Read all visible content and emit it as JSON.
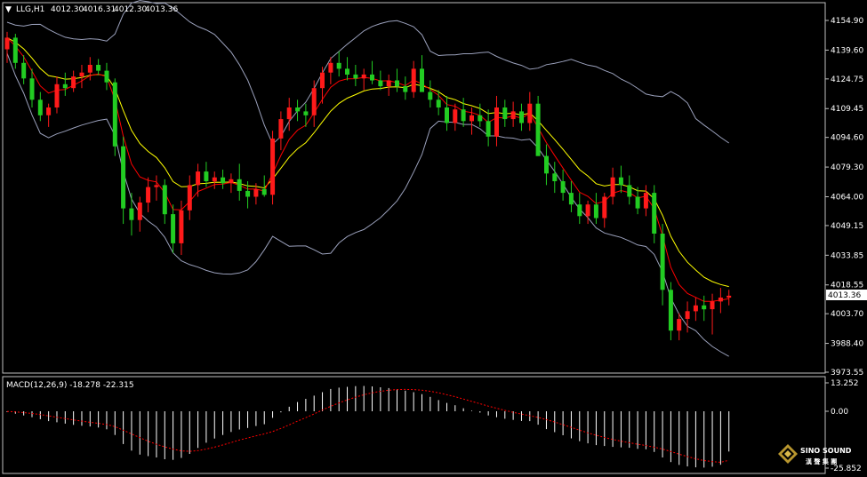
{
  "header": {
    "arrow": "▼",
    "symbol": "LLG,H1",
    "open": "4012.30",
    "high": "4016.31",
    "low": "4012.30",
    "close": "4013.36"
  },
  "current_price_label": "4013.36",
  "macd_label": "MACD(12,26,9) -18.278 -22.315",
  "brand": {
    "name": "SINO SOUND",
    "chinese": "漢 聲 集 團"
  },
  "colors": {
    "background": "#000000",
    "up_candle": "#ff1a1a",
    "down_candle": "#22cc22",
    "fast_ma": "#ff0000",
    "slow_ma": "#ffff00",
    "bollinger": "#9aa0bb",
    "macd_histogram": "#ffffff",
    "macd_signal": "#ff0000",
    "frame": "#c0c0c0"
  },
  "chart_data": [
    {
      "type": "candlestick",
      "timeframe": "H1",
      "y_ticks": [
        "4154.90",
        "4139.60",
        "4124.75",
        "4109.45",
        "4094.60",
        "4079.30",
        "4064.00",
        "4049.15",
        "4033.85",
        "4018.55",
        "4003.70",
        "3988.40",
        "3973.55"
      ],
      "ylim": [
        3970,
        4165
      ],
      "ohlc": [
        [
          4140,
          4149,
          4133,
          4146
        ],
        [
          4146,
          4148,
          4130,
          4133
        ],
        [
          4133,
          4137,
          4122,
          4125
        ],
        [
          4125,
          4130,
          4110,
          4114
        ],
        [
          4114,
          4118,
          4103,
          4106
        ],
        [
          4106,
          4112,
          4100,
          4110
        ],
        [
          4110,
          4126,
          4107,
          4122
        ],
        [
          4122,
          4128,
          4116,
          4120
        ],
        [
          4120,
          4129,
          4118,
          4126
        ],
        [
          4126,
          4132,
          4120,
          4128
        ],
        [
          4128,
          4136,
          4124,
          4132
        ],
        [
          4132,
          4135,
          4127,
          4129
        ],
        [
          4129,
          4133,
          4119,
          4123
        ],
        [
          4123,
          4125,
          4085,
          4090
        ],
        [
          4090,
          4095,
          4050,
          4058
        ],
        [
          4058,
          4066,
          4044,
          4052
        ],
        [
          4052,
          4064,
          4046,
          4061
        ],
        [
          4061,
          4074,
          4056,
          4069
        ],
        [
          4069,
          4075,
          4062,
          4070
        ],
        [
          4070,
          4073,
          4050,
          4055
        ],
        [
          4055,
          4060,
          4035,
          4040
        ],
        [
          4040,
          4062,
          4034,
          4057
        ],
        [
          4057,
          4075,
          4052,
          4070
        ],
        [
          4070,
          4081,
          4064,
          4077
        ],
        [
          4077,
          4082,
          4069,
          4072
        ],
        [
          4072,
          4077,
          4068,
          4074
        ],
        [
          4074,
          4078,
          4068,
          4071
        ],
        [
          4071,
          4076,
          4066,
          4073
        ],
        [
          4073,
          4081,
          4062,
          4067
        ],
        [
          4067,
          4072,
          4058,
          4064
        ],
        [
          4064,
          4071,
          4060,
          4068
        ],
        [
          4068,
          4075,
          4064,
          4065
        ],
        [
          4065,
          4098,
          4060,
          4094
        ],
        [
          4094,
          4108,
          4088,
          4104
        ],
        [
          4104,
          4115,
          4098,
          4110
        ],
        [
          4110,
          4114,
          4103,
          4108
        ],
        [
          4108,
          4112,
          4100,
          4106
        ],
        [
          4106,
          4124,
          4100,
          4120
        ],
        [
          4120,
          4131,
          4112,
          4128
        ],
        [
          4128,
          4136,
          4122,
          4133
        ],
        [
          4133,
          4139,
          4126,
          4130
        ],
        [
          4130,
          4136,
          4124,
          4127
        ],
        [
          4127,
          4132,
          4121,
          4125
        ],
        [
          4125,
          4130,
          4119,
          4127
        ],
        [
          4127,
          4134,
          4122,
          4124
        ],
        [
          4124,
          4129,
          4119,
          4121
        ],
        [
          4121,
          4127,
          4116,
          4124
        ],
        [
          4124,
          4130,
          4118,
          4121
        ],
        [
          4121,
          4126,
          4114,
          4118
        ],
        [
          4118,
          4134,
          4115,
          4130
        ],
        [
          4130,
          4137,
          4122,
          4118
        ],
        [
          4118,
          4124,
          4110,
          4114
        ],
        [
          4114,
          4119,
          4106,
          4110
        ],
        [
          4110,
          4116,
          4098,
          4102
        ],
        [
          4102,
          4112,
          4098,
          4109
        ],
        [
          4109,
          4115,
          4100,
          4103
        ],
        [
          4103,
          4110,
          4096,
          4106
        ],
        [
          4106,
          4112,
          4100,
          4103
        ],
        [
          4103,
          4109,
          4090,
          4095
        ],
        [
          4095,
          4116,
          4090,
          4110
        ],
        [
          4110,
          4114,
          4100,
          4104
        ],
        [
          4104,
          4113,
          4100,
          4108
        ],
        [
          4108,
          4112,
          4098,
          4102
        ],
        [
          4102,
          4118,
          4098,
          4112
        ],
        [
          4112,
          4116,
          4094,
          4085
        ],
        [
          4085,
          4091,
          4070,
          4076
        ],
        [
          4076,
          4082,
          4066,
          4072
        ],
        [
          4072,
          4078,
          4062,
          4066
        ],
        [
          4066,
          4072,
          4056,
          4060
        ],
        [
          4060,
          4066,
          4050,
          4054
        ],
        [
          4054,
          4062,
          4050,
          4060
        ],
        [
          4060,
          4066,
          4050,
          4053
        ],
        [
          4053,
          4066,
          4048,
          4064
        ],
        [
          4064,
          4079,
          4060,
          4074
        ],
        [
          4074,
          4080,
          4066,
          4070
        ],
        [
          4070,
          4075,
          4060,
          4064
        ],
        [
          4064,
          4069,
          4055,
          4058
        ],
        [
          4058,
          4070,
          4054,
          4066
        ],
        [
          4066,
          4070,
          4040,
          4045
        ],
        [
          4045,
          4050,
          4008,
          4016
        ],
        [
          4016,
          4020,
          3990,
          3995
        ],
        [
          3995,
          4004,
          3990,
          4001
        ],
        [
          4001,
          4010,
          3994,
          4005
        ],
        [
          4005,
          4012,
          4000,
          4008
        ],
        [
          4008,
          4013,
          4000,
          4006
        ],
        [
          4006,
          4014,
          3993,
          4010
        ],
        [
          4010,
          4017,
          4004,
          4012
        ],
        [
          4012,
          4016,
          4008,
          4013
        ]
      ]
    },
    {
      "type": "bar",
      "series_type": "MACD histogram with signal line",
      "ytick_labels": [
        "13.252",
        "0.00",
        "-25.852"
      ],
      "ylim": [
        -25.852,
        13.252
      ],
      "histogram": [
        -0.4,
        -1.1,
        -1.9,
        -2.7,
        -3.6,
        -4.5,
        -5.0,
        -5.6,
        -6.2,
        -6.6,
        -6.9,
        -7.4,
        -8.2,
        -10.8,
        -14.9,
        -17.9,
        -19.7,
        -20.4,
        -21.0,
        -21.8,
        -22.1,
        -21.2,
        -19.4,
        -16.7,
        -14.3,
        -12.4,
        -10.8,
        -9.4,
        -8.3,
        -7.6,
        -6.7,
        -5.9,
        -3.0,
        -0.5,
        2.1,
        4.3,
        5.8,
        7.3,
        8.9,
        10.4,
        11.0,
        11.4,
        11.7,
        11.8,
        11.6,
        11.2,
        10.8,
        10.3,
        9.6,
        8.9,
        8.0,
        6.7,
        5.2,
        3.9,
        2.8,
        1.4,
        0.3,
        -0.6,
        -1.9,
        -2.7,
        -3.4,
        -3.9,
        -4.4,
        -4.5,
        -6.1,
        -8.1,
        -9.5,
        -10.9,
        -12.3,
        -13.6,
        -14.6,
        -15.4,
        -15.8,
        -16.2,
        -16.4,
        -16.6,
        -17.1,
        -17.3,
        -18.5,
        -21.0,
        -23.1,
        -24.4,
        -25.1,
        -25.5,
        -25.6,
        -25.2,
        -24.3,
        -18.3
      ],
      "signal": [
        -0.1,
        -0.3,
        -0.6,
        -1.0,
        -1.5,
        -2.1,
        -2.7,
        -3.3,
        -3.9,
        -4.5,
        -5.0,
        -5.5,
        -6.0,
        -7.0,
        -8.6,
        -10.3,
        -12.0,
        -13.6,
        -15.0,
        -16.2,
        -17.2,
        -18.0,
        -18.2,
        -17.9,
        -17.2,
        -16.3,
        -15.3,
        -14.2,
        -13.1,
        -12.1,
        -11.2,
        -10.3,
        -9.2,
        -7.8,
        -6.2,
        -4.5,
        -2.9,
        -1.2,
        0.6,
        2.3,
        3.9,
        5.3,
        6.6,
        7.7,
        8.6,
        9.3,
        9.8,
        10.1,
        10.2,
        10.1,
        9.8,
        9.3,
        8.6,
        7.7,
        6.8,
        5.7,
        4.6,
        3.5,
        2.4,
        1.4,
        0.4,
        -0.5,
        -1.3,
        -2.0,
        -2.8,
        -3.8,
        -4.9,
        -6.1,
        -7.3,
        -8.6,
        -9.8,
        -10.9,
        -11.9,
        -12.8,
        -13.6,
        -14.3,
        -15.0,
        -15.6,
        -16.3,
        -17.2,
        -18.3,
        -19.5,
        -20.6,
        -21.6,
        -22.4,
        -22.9,
        -23.2,
        -22.3
      ]
    }
  ]
}
